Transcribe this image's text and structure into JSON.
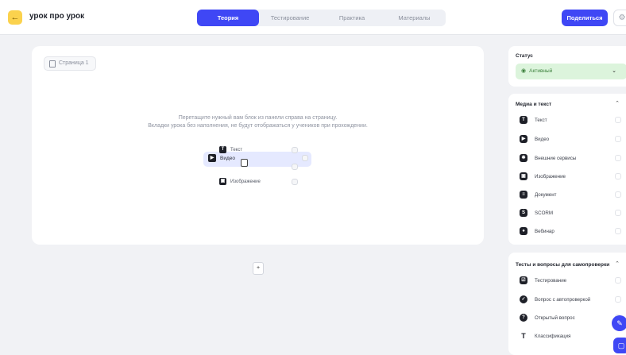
{
  "header": {
    "back_icon": "arrow-left-icon",
    "title": "урок про урок",
    "tabs": [
      {
        "label": "Теория",
        "active": true
      },
      {
        "label": "Тестирование",
        "active": false
      },
      {
        "label": "Практика",
        "active": false
      },
      {
        "label": "Материалы",
        "active": false
      }
    ],
    "share_label": "Поделиться",
    "settings_icon": "gear-icon",
    "accent_color": "#3f47f5",
    "back_color": "#fbd24d"
  },
  "canvas": {
    "page_label": "Страница 1",
    "hint_line1": "Перетащите нужный вам блок из панели справа на страницу.",
    "hint_line2": "Вкладки урока без наполнения, не будут отображаться у учеников при прохождении.",
    "drag_items": [
      {
        "label": "Текст",
        "icon": "text-icon"
      },
      {
        "label": "Видео",
        "icon": "video-icon"
      },
      {
        "label": "Изображение",
        "icon": "image-icon"
      }
    ],
    "add_page_icon": "file-plus-icon"
  },
  "sidebar": {
    "status_title": "Статус",
    "status_value": "Активный",
    "status_color": "#dcf4dc",
    "media_title": "Медиа и текст",
    "media_items": [
      {
        "label": "Текст",
        "icon": "text-icon",
        "glyph": "T"
      },
      {
        "label": "Видео",
        "icon": "video-icon",
        "glyph": "▶"
      },
      {
        "label": "Внешние сервисы",
        "icon": "puzzle-icon",
        "glyph": "✱"
      },
      {
        "label": "Изображение",
        "icon": "image-icon",
        "glyph": "▣"
      },
      {
        "label": "Документ",
        "icon": "document-icon",
        "glyph": "≡"
      },
      {
        "label": "SCORM",
        "icon": "scorm-icon",
        "glyph": "S"
      },
      {
        "label": "Вебинар",
        "icon": "webinar-icon",
        "glyph": "●"
      }
    ],
    "tests_title": "Тесты и вопросы для самопроверки",
    "test_items": [
      {
        "label": "Тестирование",
        "icon": "test-icon",
        "glyph": "☑"
      },
      {
        "label": "Вопрос с автопроверкой",
        "icon": "check-circle-icon",
        "glyph": "✓"
      },
      {
        "label": "Открытый вопрос",
        "icon": "chat-icon",
        "glyph": "?"
      },
      {
        "label": "Классификация",
        "icon": "classification-icon",
        "glyph": "T"
      }
    ]
  }
}
